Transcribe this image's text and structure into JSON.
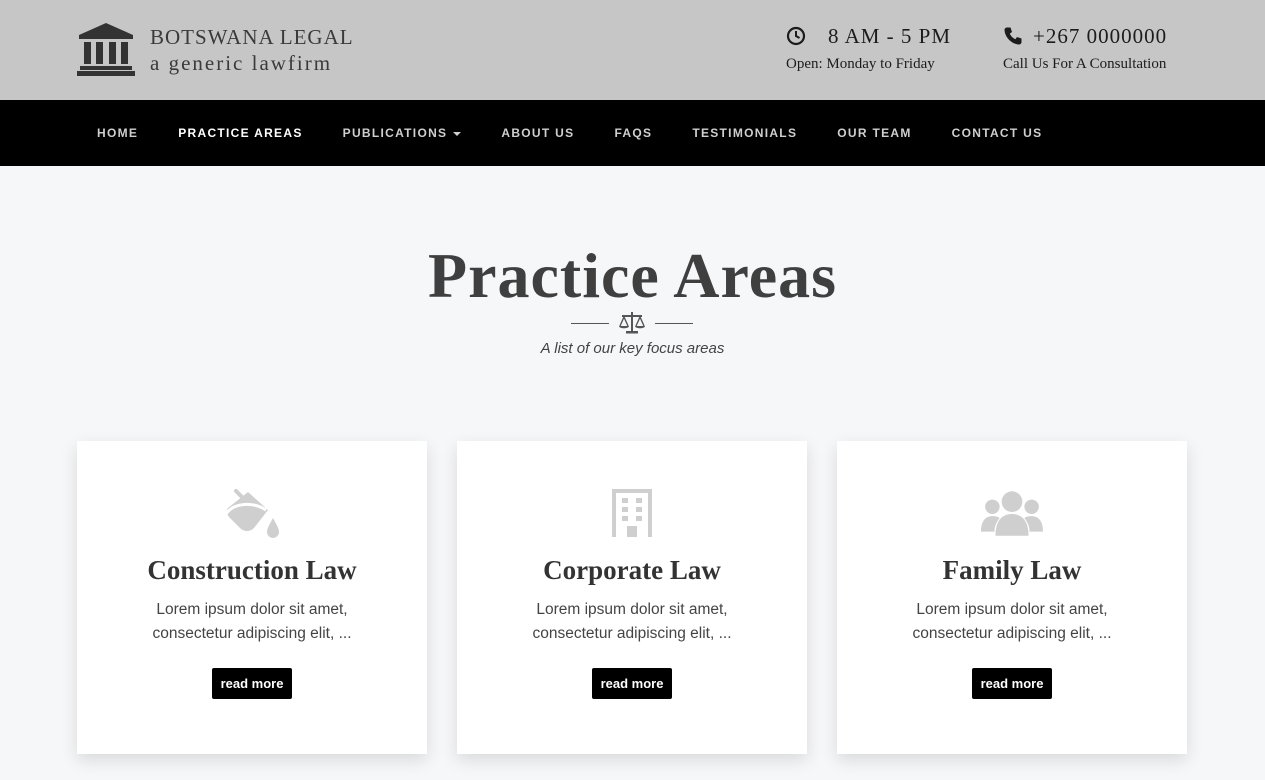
{
  "brand": {
    "name": "BOTSWANA LEGAL",
    "tagline": "a generic lawfirm",
    "icon": "courthouse-icon"
  },
  "hours": {
    "main": "8 AM - 5 PM",
    "sub": "Open: Monday to Friday",
    "icon": "clock-icon"
  },
  "phone": {
    "main": "+267 0000000",
    "sub": "Call Us For A Consultation",
    "icon": "phone-icon"
  },
  "nav": {
    "items": [
      {
        "label": "HOME"
      },
      {
        "label": "PRACTICE AREAS"
      },
      {
        "label": "PUBLICATIONS"
      },
      {
        "label": "ABOUT US"
      },
      {
        "label": "FAQS"
      },
      {
        "label": "TESTIMONIALS"
      },
      {
        "label": "OUR TEAM"
      },
      {
        "label": "CONTACT US"
      }
    ],
    "active": "PRACTICE AREAS"
  },
  "section": {
    "title": "Practice Areas",
    "subtitle": "A list of our key focus areas",
    "divider_icon": "balance-scale-icon"
  },
  "cards": [
    {
      "title": "Construction Law",
      "text": "Lorem ipsum dolor sit amet, consectetur adipiscing elit, ...",
      "button": "read more",
      "icon": "paint-bucket-icon"
    },
    {
      "title": "Corporate Law",
      "text": "Lorem ipsum dolor sit amet, consectetur adipiscing elit, ...",
      "button": "read more",
      "icon": "building-icon"
    },
    {
      "title": "Family Law",
      "text": "Lorem ipsum dolor sit amet, consectetur adipiscing elit, ...",
      "button": "read more",
      "icon": "users-icon"
    }
  ],
  "colors": {
    "topbar": "#c6c6c6",
    "nav": "#000000",
    "page": "#f6f7f9",
    "card_icon": "#cfcfcf"
  }
}
